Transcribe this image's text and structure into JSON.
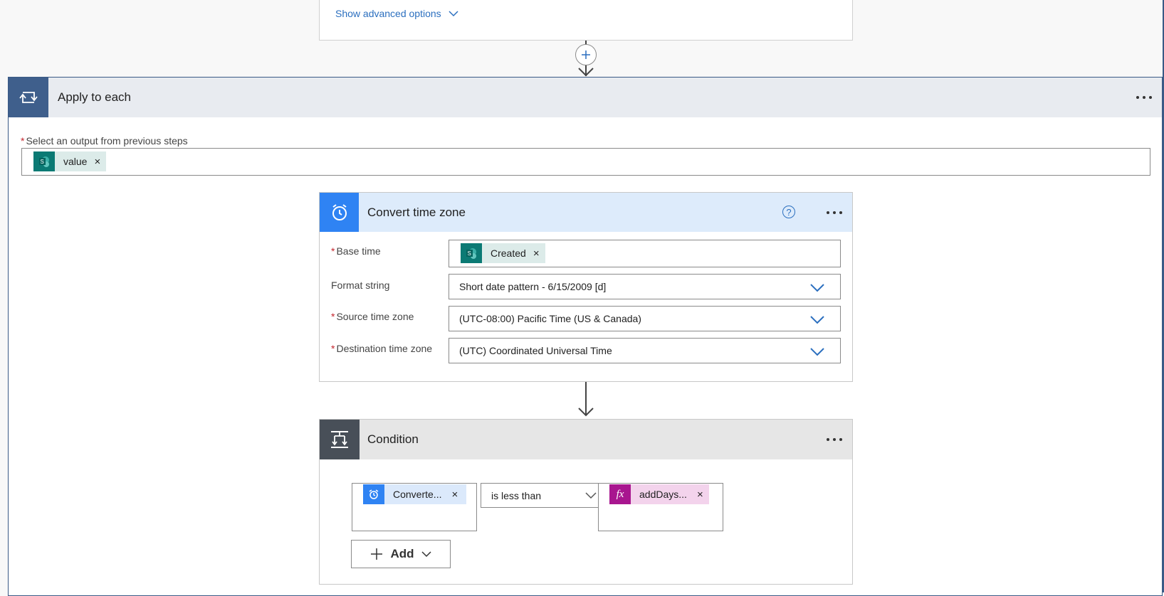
{
  "top_card": {
    "advanced_link": "Show advanced options"
  },
  "apply_to_each": {
    "title": "Apply to each",
    "output_label": "Select an output from previous steps",
    "output_token": "value"
  },
  "convert_time_zone": {
    "title": "Convert time zone",
    "help": "?",
    "fields": {
      "base_time": {
        "label": "Base time",
        "token": "Created"
      },
      "format_string": {
        "label": "Format string",
        "value": "Short date pattern - 6/15/2009 [d]"
      },
      "source_tz": {
        "label": "Source time zone",
        "value": "(UTC-08:00) Pacific Time (US & Canada)"
      },
      "dest_tz": {
        "label": "Destination time zone",
        "value": "(UTC) Coordinated Universal Time"
      }
    }
  },
  "condition": {
    "title": "Condition",
    "left_token": "Converte...",
    "operator": "is less than",
    "right_token": "addDays...",
    "add_label": "Add"
  },
  "token_remove": "×",
  "colors": {
    "accent_blue": "#2f83f3",
    "apply_icon": "#3f5f8c",
    "sharepoint": "#0b7a74",
    "expression": "#a8168f",
    "required": "#c4262e"
  }
}
